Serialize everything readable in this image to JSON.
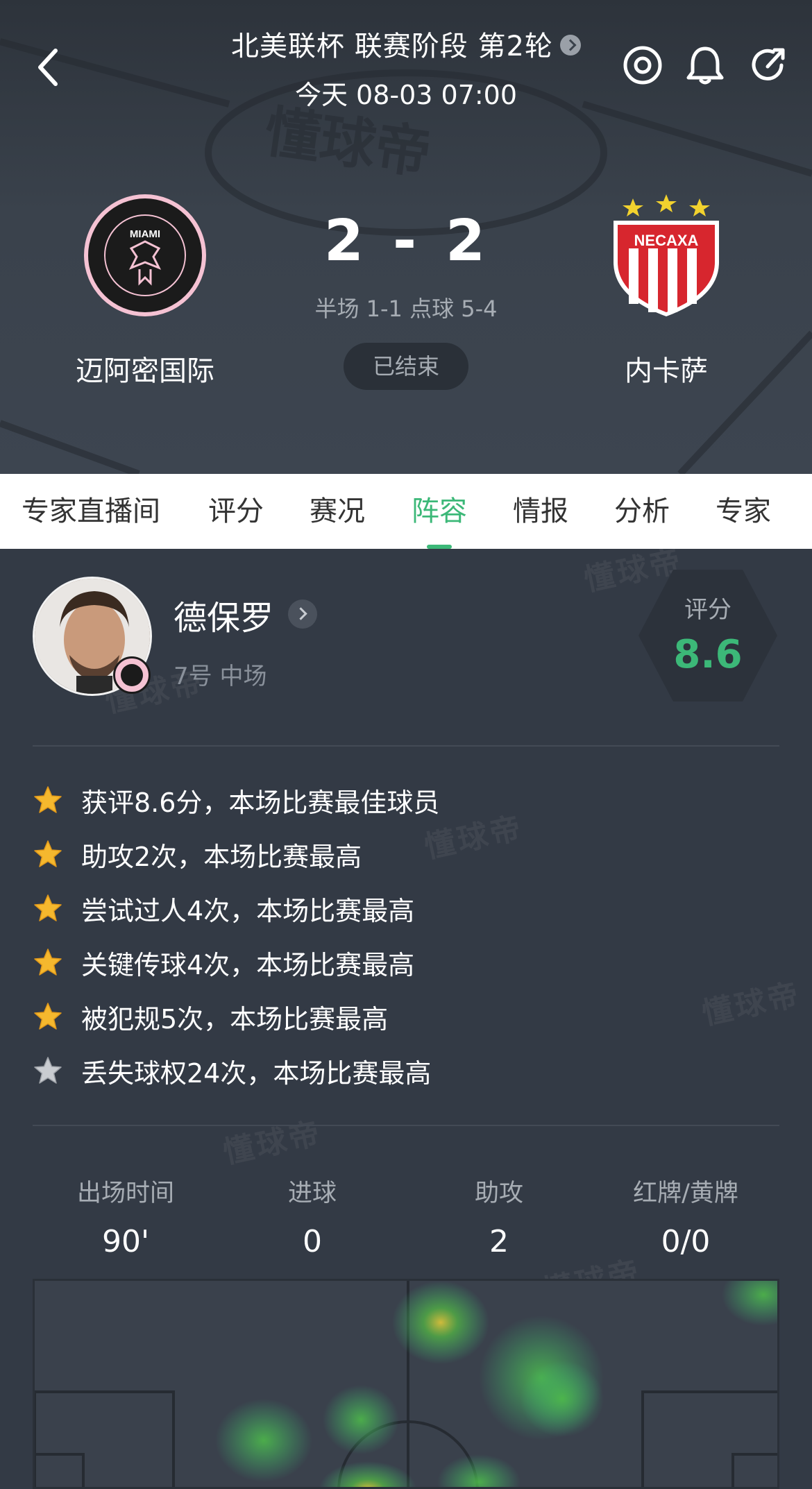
{
  "header": {
    "competition": "北美联杯 联赛阶段 第2轮",
    "time": "今天 08-03 07:00",
    "home_team": "迈阿密国际",
    "away_team": "内卡萨",
    "home_score": "2",
    "away_score": "2",
    "score_separator": "-",
    "sub_score": "半场 1-1 点球 5-4",
    "status": "已结束",
    "home_logo_text": "MIAMI",
    "away_logo_text": "NECAXA"
  },
  "tabs": [
    {
      "label": "专家直播间",
      "active": false
    },
    {
      "label": "评分",
      "active": false
    },
    {
      "label": "赛况",
      "active": false
    },
    {
      "label": "阵容",
      "active": true
    },
    {
      "label": "情报",
      "active": false
    },
    {
      "label": "分析",
      "active": false
    },
    {
      "label": "专家",
      "active": false
    }
  ],
  "player": {
    "name": "德保罗",
    "meta": "7号  中场",
    "rating_label": "评分",
    "rating_value": "8.6"
  },
  "highlights": [
    {
      "text": "获评8.6分，本场比赛最佳球员",
      "star": "gold"
    },
    {
      "text": "助攻2次，本场比赛最高",
      "star": "gold"
    },
    {
      "text": "尝试过人4次，本场比赛最高",
      "star": "gold"
    },
    {
      "text": "关键传球4次，本场比赛最高",
      "star": "gold"
    },
    {
      "text": "被犯规5次，本场比赛最高",
      "star": "gold"
    },
    {
      "text": "丢失球权24次，本场比赛最高",
      "star": "silver"
    }
  ],
  "stats": [
    {
      "label": "出场时间",
      "value": "90'"
    },
    {
      "label": "进球",
      "value": "0"
    },
    {
      "label": "助攻",
      "value": "2"
    },
    {
      "label": "红牌/黄牌",
      "value": "0/0"
    }
  ],
  "watermark": "懂球帝",
  "colors": {
    "accent": "#3cb878",
    "background": "#333a45",
    "star_gold": "#f5b82e",
    "star_silver": "#c9ccd1"
  },
  "icons": [
    "back-icon",
    "target-icon",
    "bell-icon",
    "share-icon",
    "star-icon"
  ]
}
